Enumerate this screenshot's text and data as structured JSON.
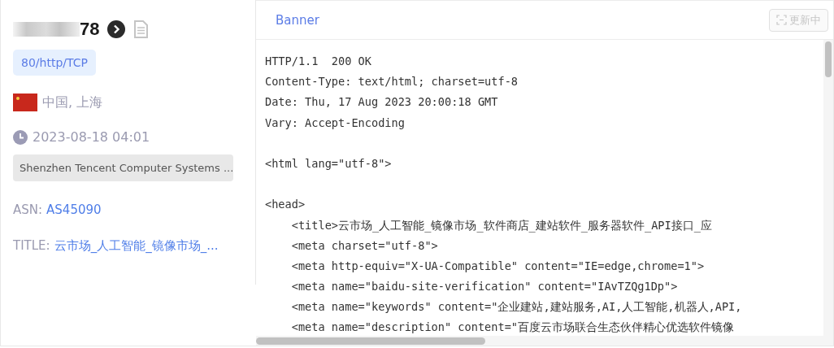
{
  "host": {
    "ip_visible": "78",
    "redacted": true
  },
  "port_tag": "80/http/TCP",
  "location": {
    "text": "中国, 上海"
  },
  "time": "2023-08-18 04:01",
  "org": "Shenzhen Tencent Computer Systems ...",
  "asn": {
    "label": "ASN:",
    "value": "AS45090"
  },
  "title": {
    "label": "TITLE:",
    "value": "云市场_人工智能_镜像市场_..."
  },
  "tabs": [
    {
      "label": "Banner",
      "selected": true
    }
  ],
  "update_button": {
    "label": "更新中",
    "disabled": true
  },
  "banner_blocks": [
    {
      "lines": [
        "HTTP/1.1  200 OK",
        "Content-Type: text/html; charset=utf-8",
        "Date: Thu, 17 Aug 2023 20:00:18 GMT",
        "Vary: Accept-Encoding"
      ]
    },
    {
      "lines": [
        "<html lang=\"utf-8\">"
      ]
    },
    {
      "lines": [
        "<head>",
        "    <title>云市场_人工智能_镜像市场_软件商店_建站软件_服务器软件_API接口_应",
        "    <meta charset=\"utf-8\">",
        "    <meta http-equiv=\"X-UA-Compatible\" content=\"IE=edge,chrome=1\">",
        "    <meta name=\"baidu-site-verification\" content=\"IAvTZQg1Dp\">",
        "    <meta name=\"keywords\" content=\"企业建站,建站服务,AI,人工智能,机器人,API,",
        "    <meta name=\"description\" content=\"百度云市场联合生态伙伴精心优选软件镜像"
      ]
    }
  ]
}
